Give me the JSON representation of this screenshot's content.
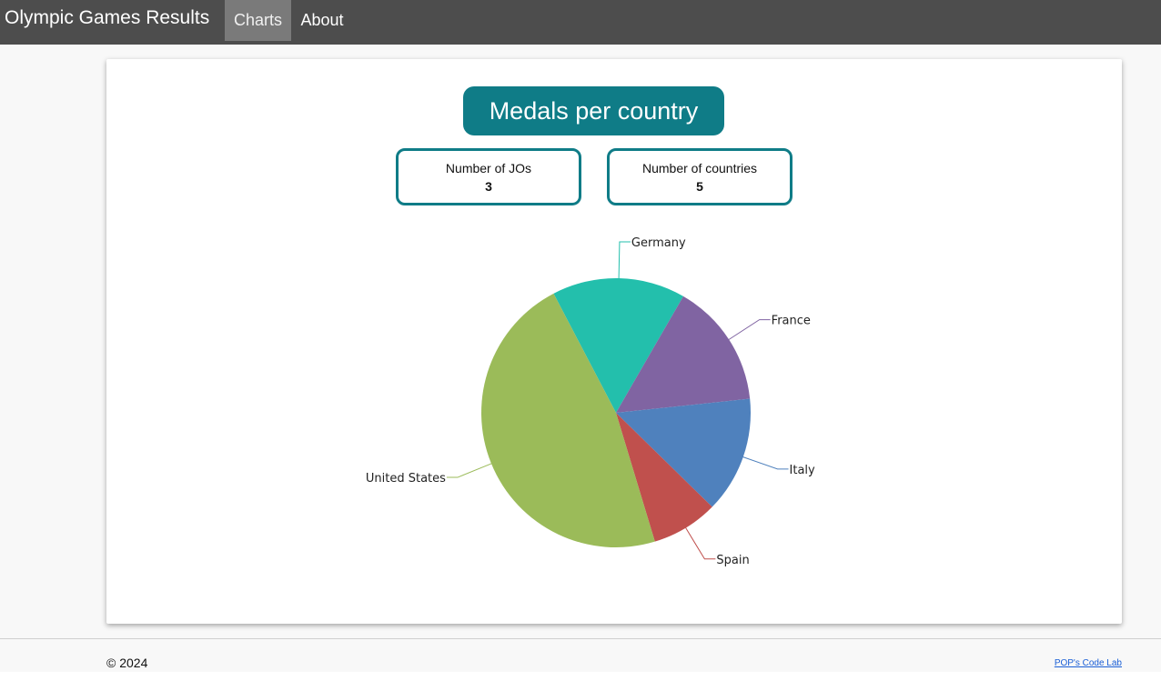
{
  "navbar": {
    "brand": "Olympic Games Results",
    "tabs": [
      {
        "label": "Charts",
        "active": true
      },
      {
        "label": "About",
        "active": false
      }
    ]
  },
  "main": {
    "title": "Medals per country",
    "stats": [
      {
        "label": "Number of JOs",
        "value": "3"
      },
      {
        "label": "Number of countries",
        "value": "5"
      }
    ]
  },
  "chart_data": {
    "type": "pie",
    "title": "",
    "legend": "none",
    "labels_outside": true,
    "series": [
      {
        "label": "Germany",
        "value": 16,
        "color": "#23bfac"
      },
      {
        "label": "France",
        "value": 15,
        "color": "#8064a2"
      },
      {
        "label": "Italy",
        "value": 14,
        "color": "#4f81bd"
      },
      {
        "label": "Spain",
        "value": 8,
        "color": "#c0504d"
      },
      {
        "label": "United States",
        "value": 47,
        "color": "#9bbb59"
      }
    ]
  },
  "footer": {
    "copyright": "© 2024",
    "link": "POP's Code Lab"
  },
  "colors": {
    "navbar": "#4d4d4d",
    "accent": "#0f7c87",
    "link": "#1a5fd6"
  }
}
